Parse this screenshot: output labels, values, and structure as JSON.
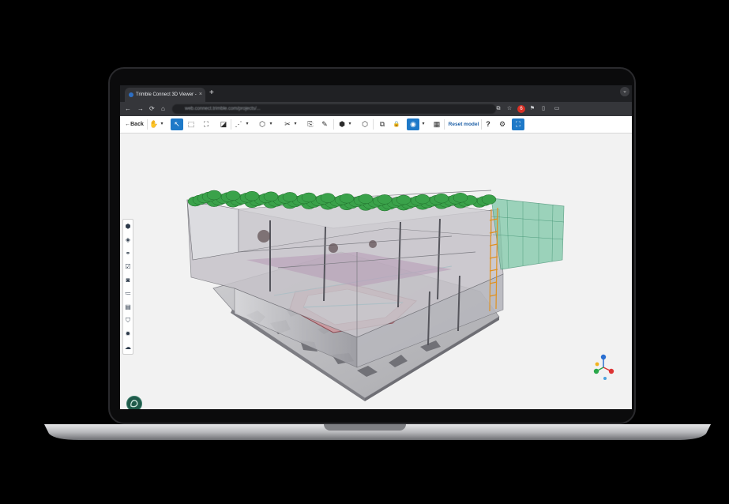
{
  "browser": {
    "tab_title": "Trimble Connect 3D Viewer -",
    "tab_close": "×",
    "new_tab": "+",
    "url": "web.connect.trimble.com/projects/...",
    "nav": {
      "back": "←",
      "forward": "→",
      "reload": "⟳",
      "home": "⌂"
    },
    "extensions": [
      "⧉",
      "☆",
      "6",
      "⚑",
      "▯",
      "▭"
    ]
  },
  "toolbar": {
    "back_label": "Back",
    "reset_label": "Reset model",
    "tools": [
      {
        "name": "pan-tool-icon",
        "glyph": "✋"
      },
      {
        "name": "select-tool-icon",
        "glyph": "↖",
        "active": true
      },
      {
        "name": "box-select-icon",
        "glyph": "⬚"
      },
      {
        "name": "fit-frame-icon",
        "glyph": "⛶"
      },
      {
        "name": "measure-icon",
        "glyph": "◪"
      },
      {
        "name": "point-tool-icon",
        "glyph": "⋰"
      },
      {
        "name": "shape-tool-icon",
        "glyph": "⬡"
      },
      {
        "name": "clip-tool-icon",
        "glyph": "✂"
      },
      {
        "name": "snapshot-icon",
        "glyph": "⎘"
      },
      {
        "name": "markup-icon",
        "glyph": "✎"
      },
      {
        "name": "cube-view-icon",
        "glyph": "⬢"
      },
      {
        "name": "ortho-view-icon",
        "glyph": "⬡"
      },
      {
        "name": "layers-icon",
        "glyph": "⧉"
      },
      {
        "name": "lock-icon",
        "glyph": "🔒"
      },
      {
        "name": "visibility-icon",
        "glyph": "◉",
        "active": true
      },
      {
        "name": "calculator-icon",
        "glyph": "▦"
      },
      {
        "name": "help-icon",
        "glyph": "?"
      },
      {
        "name": "settings-icon",
        "glyph": "⚙"
      },
      {
        "name": "fullscreen-icon",
        "glyph": "⛶",
        "active": true
      }
    ]
  },
  "sidebar": [
    {
      "name": "model-tree-icon",
      "glyph": "⬢"
    },
    {
      "name": "layers-stack-icon",
      "glyph": "◈"
    },
    {
      "name": "link-icon",
      "glyph": "⚭"
    },
    {
      "name": "checklist-icon",
      "glyph": "☑"
    },
    {
      "name": "camera-icon",
      "glyph": "◙"
    },
    {
      "name": "hierarchy-icon",
      "glyph": "≔"
    },
    {
      "name": "table-icon",
      "glyph": "▤"
    },
    {
      "name": "shield-icon",
      "glyph": "⛉"
    },
    {
      "name": "gear-bug-icon",
      "glyph": "✹"
    },
    {
      "name": "cloud-icon",
      "glyph": "☁"
    }
  ],
  "colors": {
    "accent": "#1e79c8",
    "canopy": "#3aa24a",
    "logo": "#1f5a4a"
  }
}
